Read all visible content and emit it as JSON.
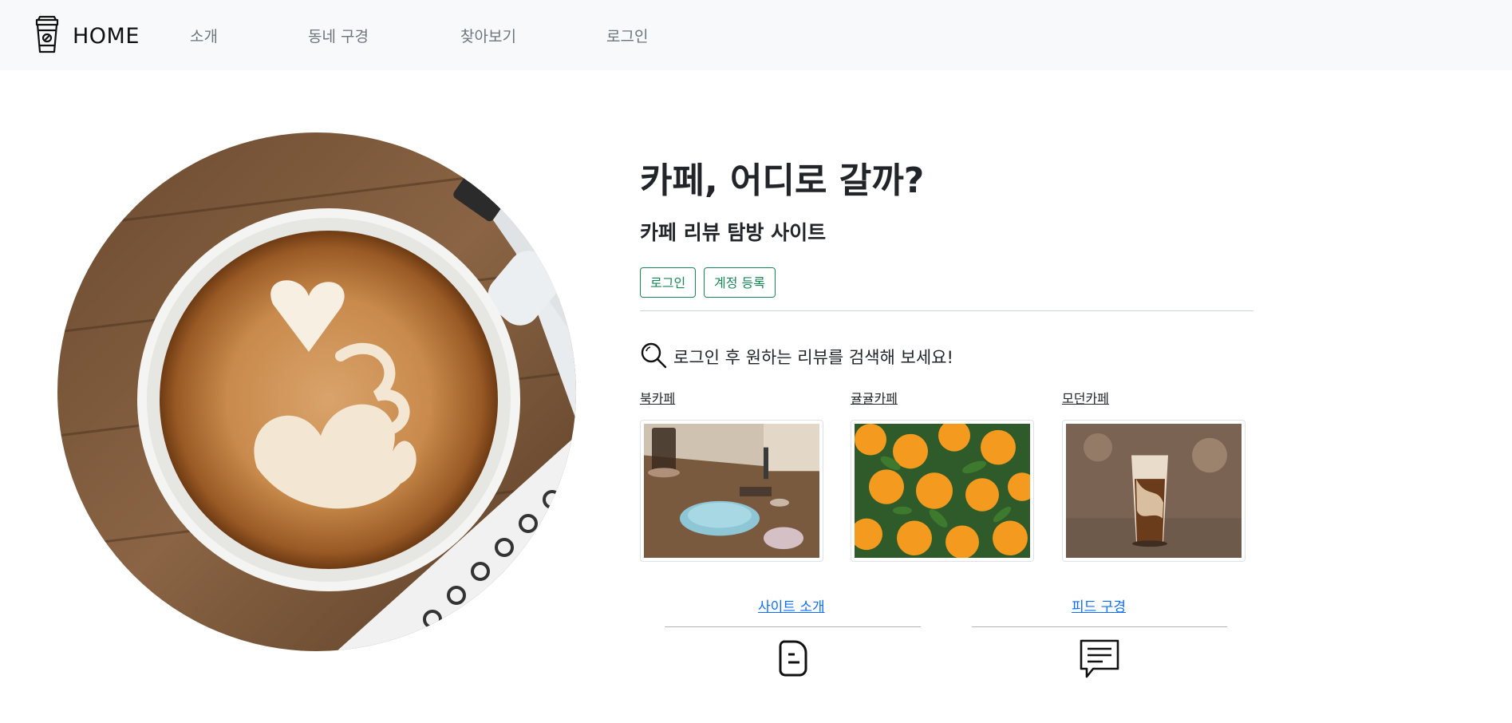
{
  "navbar": {
    "brand_icon": "coffee-cup-icon",
    "brand_label": "HOME",
    "links": [
      "소개",
      "동네 구경",
      "찾아보기",
      "로그인"
    ]
  },
  "hero": {
    "image_alt": "latte-art-coffee-image",
    "title": "카페, 어디로 갈까?",
    "subtitle": "카페 리뷰 탐방 사이트",
    "login_button": "로그인",
    "register_button": "계정 등록",
    "search_icon": "search-icon",
    "search_hint": "로그인 후 원하는 리뷰를 검색해 보세요!"
  },
  "cafes": [
    {
      "name": "북카페",
      "image": "book-cafe-table-image"
    },
    {
      "name": "귤귤카페",
      "image": "tangerines-image"
    },
    {
      "name": "모던카페",
      "image": "iced-latte-image"
    }
  ],
  "footer": {
    "intro_link": "사이트 소개",
    "intro_icon": "document-icon",
    "feed_link": "피드 구경",
    "feed_icon": "chat-bubble-icon"
  },
  "colors": {
    "navbar_bg": "#f8f9fa",
    "nav_link": "#6c757d",
    "button_outline": "#198754",
    "link_blue": "#0d6efd"
  }
}
